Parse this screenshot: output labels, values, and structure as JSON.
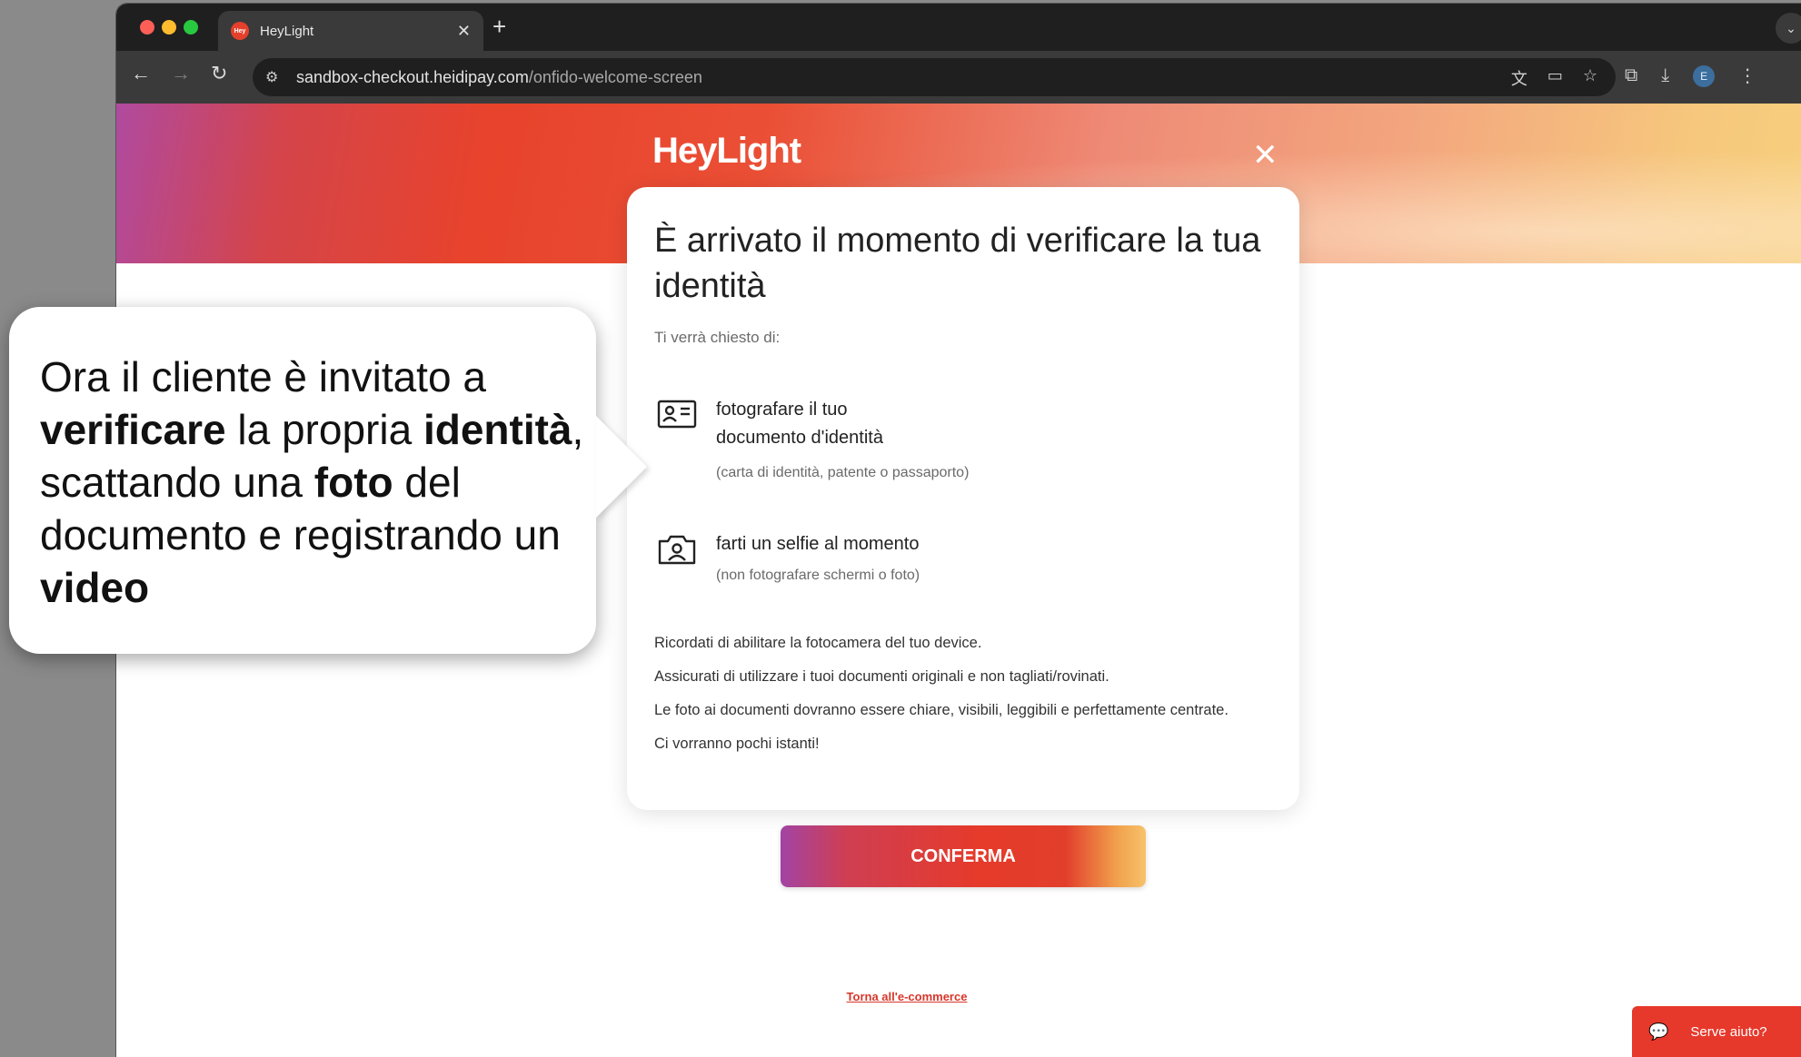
{
  "browser": {
    "tab_title": "HeyLight",
    "tab_favicon_text": "Hey",
    "url_host": "sandbox-checkout.heidipay.com",
    "url_path": "/onfido-welcome-screen",
    "profile_initial": "E"
  },
  "page": {
    "brand": "HeyLight",
    "card": {
      "title": "È arrivato il momento di verificare la tua identità",
      "subtitle": "Ti verrà chiesto di:",
      "requirements": [
        {
          "icon": "id-card-icon",
          "line1": "fotografare il tuo",
          "line2": "documento d'identità",
          "note": "(carta di identità, patente o passaporto)"
        },
        {
          "icon": "selfie-camera-icon",
          "line1": "farti un selfie al momento",
          "line2": "",
          "note": "(non fotografare schermi o foto)"
        }
      ],
      "notes": [
        "Ricordati di abilitare la fotocamera del tuo device.",
        "Assicurati di utilizzare i tuoi documenti originali e non tagliati/rovinati.",
        "Le foto ai documenti dovranno essere chiare, visibili, leggibili e perfettamente centrate.",
        "Ci vorranno pochi istanti!"
      ]
    },
    "cta_label": "CONFERMA",
    "back_link": "Torna all'e-commerce",
    "help_label": "Serve aiuto?"
  },
  "callout": {
    "segments": [
      {
        "t": "Ora il cliente è invitato a ",
        "b": false
      },
      {
        "t": "verificare",
        "b": true
      },
      {
        "t": " la propria ",
        "b": false
      },
      {
        "t": "identità",
        "b": true
      },
      {
        "t": ", scattando una ",
        "b": false
      },
      {
        "t": "foto",
        "b": true
      },
      {
        "t": " del documento e registrando un ",
        "b": false
      },
      {
        "t": "video",
        "b": true
      }
    ]
  },
  "colors": {
    "brand_red": "#e6392b",
    "link_red": "#d8362a"
  }
}
